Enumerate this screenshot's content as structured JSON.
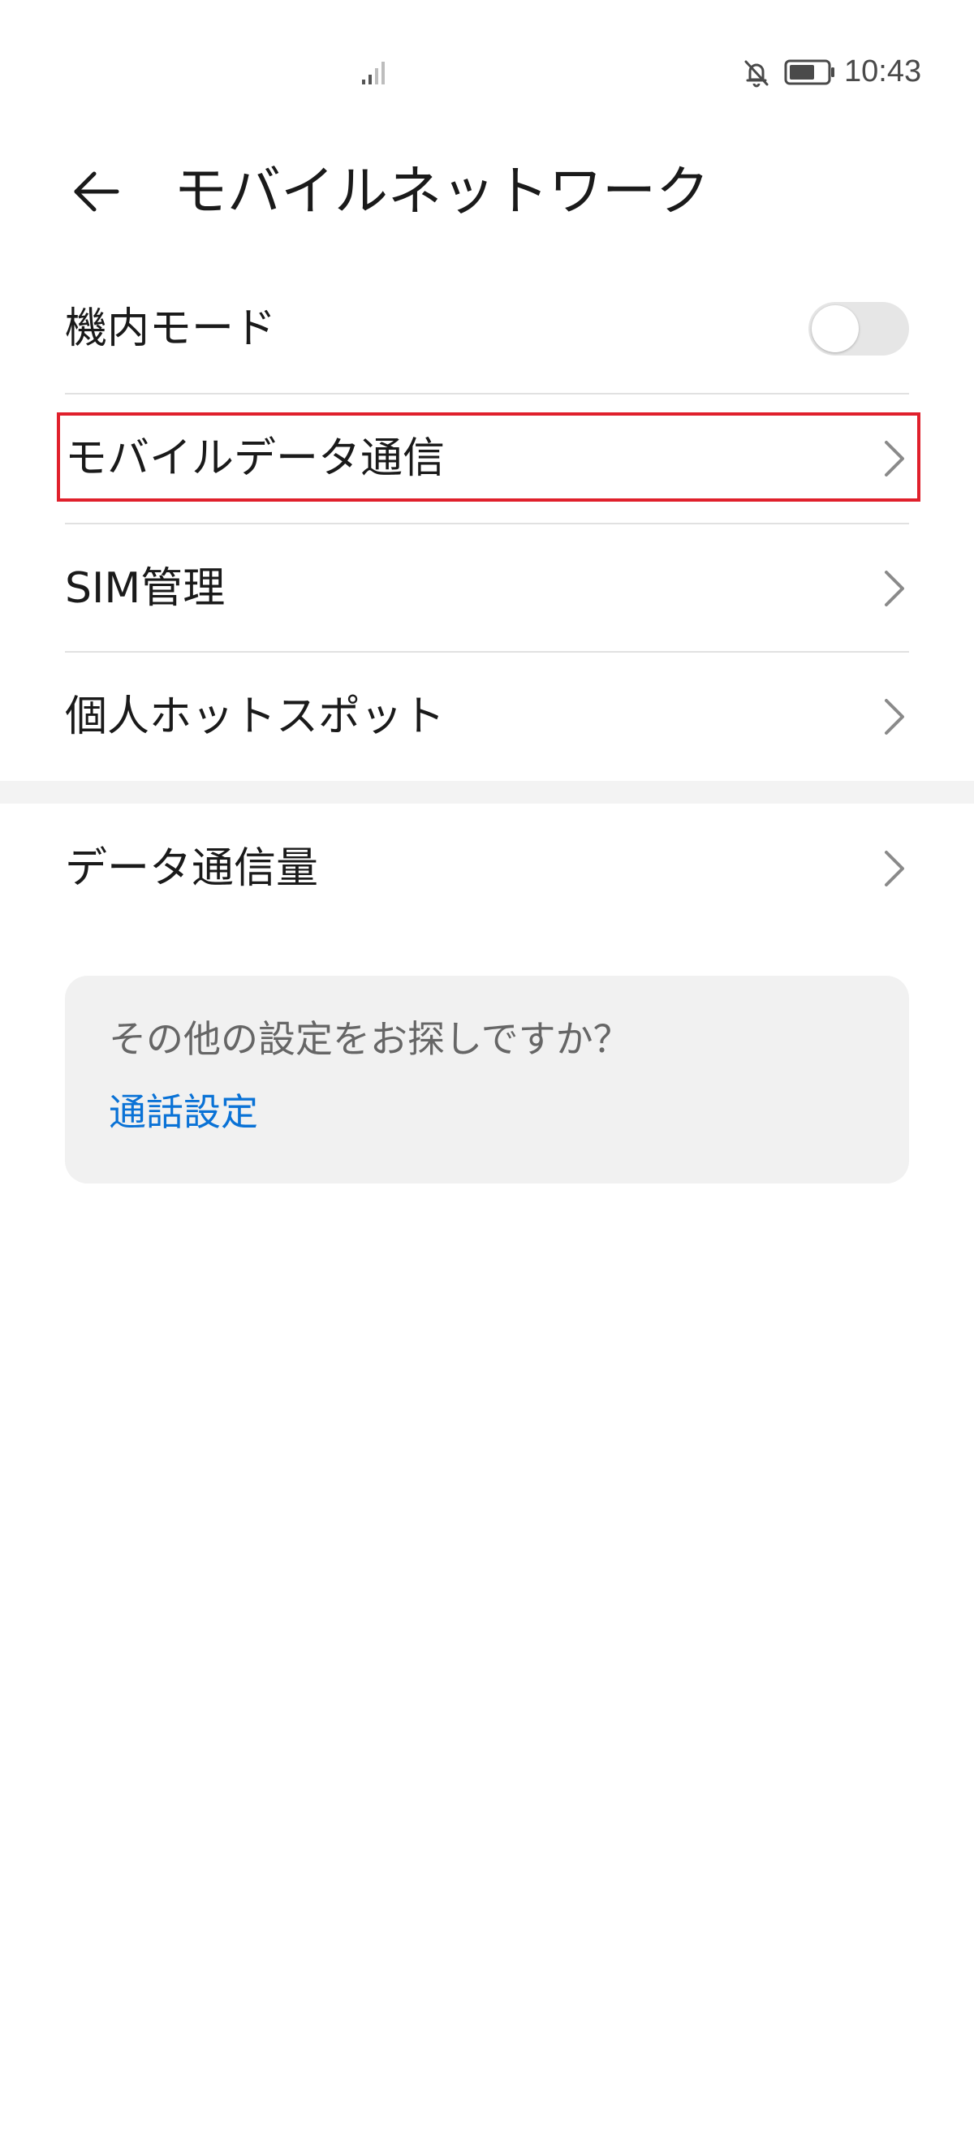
{
  "status_bar": {
    "time": "10:43",
    "icons": [
      "signal-icon",
      "bell-off-icon",
      "battery-icon"
    ]
  },
  "header": {
    "back_icon": "arrow-left-icon",
    "title": "モバイルネットワーク"
  },
  "settings": {
    "airplane_mode": {
      "label": "機内モード",
      "enabled": false
    },
    "items": [
      {
        "label": "モバイルデータ通信",
        "icon": "chevron-right-icon"
      },
      {
        "label": "SIM管理",
        "icon": "chevron-right-icon"
      },
      {
        "label": "個人ホットスポット",
        "icon": "chevron-right-icon"
      }
    ],
    "data_usage": {
      "label": "データ通信量",
      "icon": "chevron-right-icon"
    }
  },
  "suggestion": {
    "text": "その他の設定をお探しですか？",
    "link": "通話設定"
  },
  "colors": {
    "highlight": "#e0202c",
    "link": "#0a72d6",
    "toggle_off": "#e6e6e6"
  }
}
